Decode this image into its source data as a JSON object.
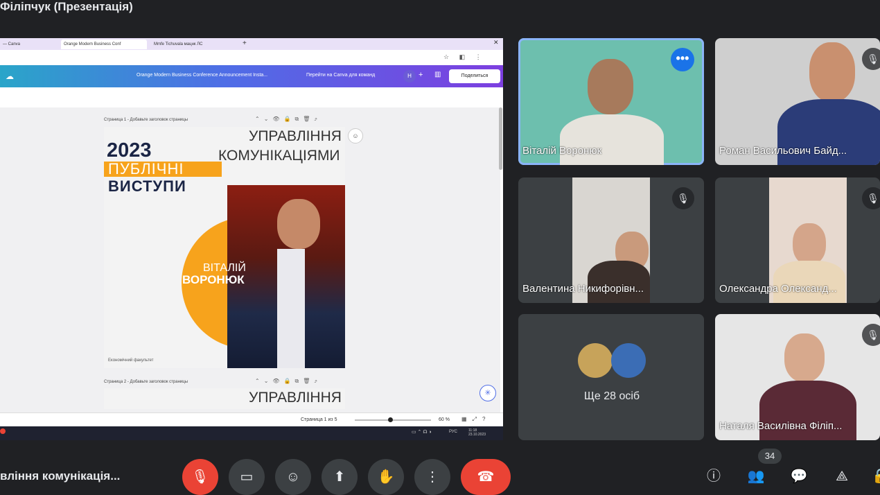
{
  "presenter_title": "Філіпчук (Презентація)",
  "browser": {
    "tabs": [
      "— Canva",
      "Orange Modern Business Conf",
      "Mmfe Tiсhuvala мацнк ЛС"
    ],
    "canva_doc_title": "Orange Modern Business Conference Announcement Insta...",
    "canva_teams": "Перейти на Canva для команд",
    "avatar_letter": "Н",
    "share_label": "Поделиться"
  },
  "slide1": {
    "page_label": "Страница 1 - Добавьте заголовок страницы",
    "year": "2023",
    "line1": "ПУБЛІЧНІ",
    "line2": "ВИСТУПИ",
    "title1": "УПРАВЛІННЯ",
    "title2": "КОМУНІКАЦІЯМИ",
    "first_name": "ВІТАЛІЙ",
    "last_name": "ВОРОНЮК",
    "footer": "Економічний факультет"
  },
  "slide2": {
    "page_label": "Страница 2 - Добавьте заголовок страницы",
    "title1": "УПРАВЛІННЯ"
  },
  "status": {
    "pages": "Страница 1 из 5",
    "zoom": "60 %"
  },
  "taskbar": {
    "lang": "РУС",
    "time": "11:18",
    "date": "23.10.2023"
  },
  "participants": [
    {
      "name": "Віталій Воронюк"
    },
    {
      "name": "Роман Васильович Байд..."
    },
    {
      "name": "Валентина Никифорівн..."
    },
    {
      "name": "Олександра Олександ..."
    },
    {
      "name": "Наталя Василівна Філіп..."
    }
  ],
  "more_participants": "Ще 28 осіб",
  "meeting_title": "вління комунікація...",
  "participant_count": "34",
  "colors": {
    "hangup": "#ea4335",
    "accent": "#1a73e8",
    "background": "#202124"
  }
}
